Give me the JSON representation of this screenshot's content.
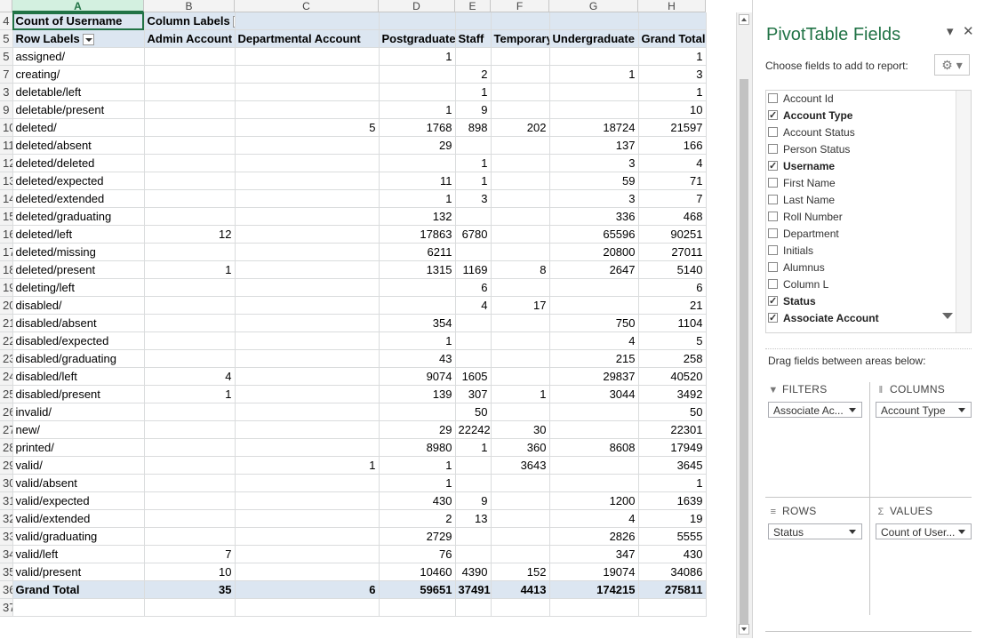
{
  "column_headers": [
    "A",
    "B",
    "C",
    "D",
    "E",
    "F",
    "G",
    "H"
  ],
  "rows": [
    {
      "n": "4",
      "cells": [
        "Count of Username",
        "Column Labels",
        "",
        "",
        "",
        "",
        "",
        ""
      ],
      "kind": "labels"
    },
    {
      "n": "5",
      "cells": [
        "Row Labels",
        "Admin Account",
        "Departmental Account",
        "Postgraduate",
        "Staff",
        "Temporary",
        "Undergraduate",
        "Grand Total"
      ],
      "kind": "hdr"
    },
    {
      "n": "5",
      "cells": [
        "assigned/",
        "",
        "",
        "1",
        "",
        "",
        "",
        "1"
      ]
    },
    {
      "n": "7",
      "cells": [
        "creating/",
        "",
        "",
        "",
        "2",
        "",
        "1",
        "3"
      ]
    },
    {
      "n": "3",
      "cells": [
        "deletable/left",
        "",
        "",
        "",
        "1",
        "",
        "",
        "1"
      ]
    },
    {
      "n": "9",
      "cells": [
        "deletable/present",
        "",
        "",
        "1",
        "9",
        "",
        "",
        "10"
      ]
    },
    {
      "n": "10",
      "cells": [
        "deleted/",
        "",
        "5",
        "1768",
        "898",
        "202",
        "18724",
        "21597"
      ]
    },
    {
      "n": "11",
      "cells": [
        "deleted/absent",
        "",
        "",
        "29",
        "",
        "",
        "137",
        "166"
      ]
    },
    {
      "n": "12",
      "cells": [
        "deleted/deleted",
        "",
        "",
        "",
        "1",
        "",
        "3",
        "4"
      ]
    },
    {
      "n": "13",
      "cells": [
        "deleted/expected",
        "",
        "",
        "11",
        "1",
        "",
        "59",
        "71"
      ]
    },
    {
      "n": "14",
      "cells": [
        "deleted/extended",
        "",
        "",
        "1",
        "3",
        "",
        "3",
        "7"
      ]
    },
    {
      "n": "15",
      "cells": [
        "deleted/graduating",
        "",
        "",
        "132",
        "",
        "",
        "336",
        "468"
      ]
    },
    {
      "n": "16",
      "cells": [
        "deleted/left",
        "12",
        "",
        "17863",
        "6780",
        "",
        "65596",
        "90251"
      ]
    },
    {
      "n": "17",
      "cells": [
        "deleted/missing",
        "",
        "",
        "6211",
        "",
        "",
        "20800",
        "27011"
      ]
    },
    {
      "n": "18",
      "cells": [
        "deleted/present",
        "1",
        "",
        "1315",
        "1169",
        "8",
        "2647",
        "5140"
      ]
    },
    {
      "n": "19",
      "cells": [
        "deleting/left",
        "",
        "",
        "",
        "6",
        "",
        "",
        "6"
      ]
    },
    {
      "n": "20",
      "cells": [
        "disabled/",
        "",
        "",
        "",
        "4",
        "17",
        "",
        "21"
      ]
    },
    {
      "n": "21",
      "cells": [
        "disabled/absent",
        "",
        "",
        "354",
        "",
        "",
        "750",
        "1104"
      ]
    },
    {
      "n": "22",
      "cells": [
        "disabled/expected",
        "",
        "",
        "1",
        "",
        "",
        "4",
        "5"
      ]
    },
    {
      "n": "23",
      "cells": [
        "disabled/graduating",
        "",
        "",
        "43",
        "",
        "",
        "215",
        "258"
      ]
    },
    {
      "n": "24",
      "cells": [
        "disabled/left",
        "4",
        "",
        "9074",
        "1605",
        "",
        "29837",
        "40520"
      ]
    },
    {
      "n": "25",
      "cells": [
        "disabled/present",
        "1",
        "",
        "139",
        "307",
        "1",
        "3044",
        "3492"
      ]
    },
    {
      "n": "26",
      "cells": [
        "invalid/",
        "",
        "",
        "",
        "50",
        "",
        "",
        "50"
      ]
    },
    {
      "n": "27",
      "cells": [
        "new/",
        "",
        "",
        "29",
        "22242",
        "30",
        "",
        "22301"
      ]
    },
    {
      "n": "28",
      "cells": [
        "printed/",
        "",
        "",
        "8980",
        "1",
        "360",
        "8608",
        "17949"
      ]
    },
    {
      "n": "29",
      "cells": [
        "valid/",
        "",
        "1",
        "1",
        "",
        "3643",
        "",
        "3645"
      ]
    },
    {
      "n": "30",
      "cells": [
        "valid/absent",
        "",
        "",
        "1",
        "",
        "",
        "",
        "1"
      ]
    },
    {
      "n": "31",
      "cells": [
        "valid/expected",
        "",
        "",
        "430",
        "9",
        "",
        "1200",
        "1639"
      ]
    },
    {
      "n": "32",
      "cells": [
        "valid/extended",
        "",
        "",
        "2",
        "13",
        "",
        "4",
        "19"
      ]
    },
    {
      "n": "33",
      "cells": [
        "valid/graduating",
        "",
        "",
        "2729",
        "",
        "",
        "2826",
        "5555"
      ]
    },
    {
      "n": "34",
      "cells": [
        "valid/left",
        "7",
        "",
        "76",
        "",
        "",
        "347",
        "430"
      ]
    },
    {
      "n": "35",
      "cells": [
        "valid/present",
        "10",
        "",
        "10460",
        "4390",
        "152",
        "19074",
        "34086"
      ]
    },
    {
      "n": "36",
      "cells": [
        "Grand Total",
        "35",
        "6",
        "59651",
        "37491",
        "4413",
        "174215",
        "275811"
      ],
      "kind": "tot"
    },
    {
      "n": "37",
      "cells": [
        "",
        "",
        "",
        "",
        "",
        "",
        "",
        ""
      ]
    }
  ],
  "pane": {
    "title": "PivotTable Fields",
    "choose_label": "Choose fields to add to report:",
    "fields": [
      {
        "label": "Account Id",
        "checked": false
      },
      {
        "label": "Account Type",
        "checked": true
      },
      {
        "label": "Account Status",
        "checked": false
      },
      {
        "label": "Person Status",
        "checked": false
      },
      {
        "label": "Username",
        "checked": true
      },
      {
        "label": "First Name",
        "checked": false
      },
      {
        "label": "Last Name",
        "checked": false
      },
      {
        "label": "Roll Number",
        "checked": false
      },
      {
        "label": "Department",
        "checked": false
      },
      {
        "label": "Initials",
        "checked": false
      },
      {
        "label": "Alumnus",
        "checked": false
      },
      {
        "label": "Column L",
        "checked": false
      },
      {
        "label": "Status",
        "checked": true
      },
      {
        "label": "Associate Account",
        "checked": true,
        "filtered": true
      }
    ],
    "drag_label": "Drag fields between areas below:",
    "filters": {
      "heading": "FILTERS",
      "item": "Associate Ac..."
    },
    "columns": {
      "heading": "COLUMNS",
      "item": "Account Type"
    },
    "rows": {
      "heading": "ROWS",
      "item": "Status"
    },
    "values": {
      "heading": "VALUES",
      "item": "Count of User..."
    }
  }
}
